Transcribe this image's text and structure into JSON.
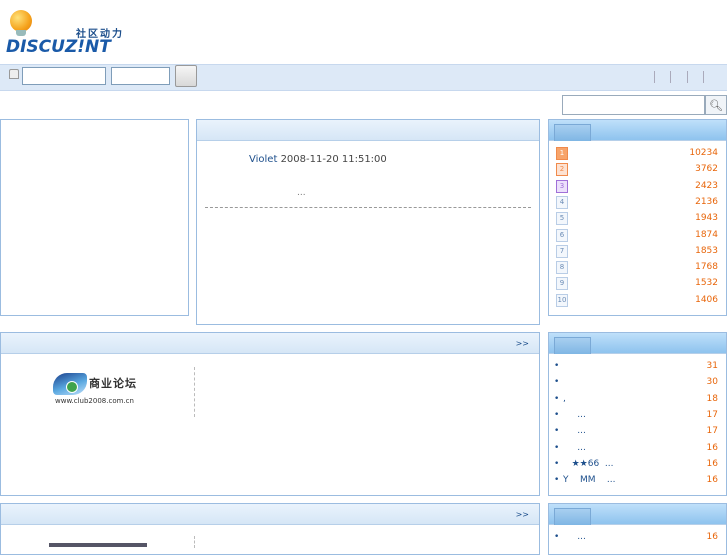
{
  "logo": {
    "cn": "社区动力",
    "en": "DISCUZ!NT"
  },
  "post": {
    "author": "Violet",
    "datetime": "2008-11-20 11:51:00",
    "excerpt": "..."
  },
  "more_label": ">>",
  "ad_logo": {
    "cn": "商业论坛",
    "url": "www.club2008.com.cn"
  },
  "ranking": [
    {
      "n": "1",
      "v": "10234",
      "c": "#f08a4b",
      "bg": "#f7a46a"
    },
    {
      "n": "2",
      "v": "3762",
      "c": "#f08a4b",
      "bg": "#fde2d2"
    },
    {
      "n": "3",
      "v": "2423",
      "c": "#a070d8",
      "bg": "#ece0fb"
    },
    {
      "n": "4",
      "v": "2136"
    },
    {
      "n": "5",
      "v": "1943"
    },
    {
      "n": "6",
      "v": "1874"
    },
    {
      "n": "7",
      "v": "1853"
    },
    {
      "n": "8",
      "v": "1768"
    },
    {
      "n": "9",
      "v": "1532"
    },
    {
      "n": "10",
      "v": "1406"
    }
  ],
  "hot_threads": [
    {
      "t": "",
      "v": "31"
    },
    {
      "t": "",
      "v": "30"
    },
    {
      "t": ",",
      "v": "18"
    },
    {
      "t": "     ...",
      "v": "17"
    },
    {
      "t": "     ...",
      "v": "17"
    },
    {
      "t": "     ...",
      "v": "16"
    },
    {
      "t": "   ★★66  ...",
      "v": "16"
    },
    {
      "t": "Y    MM    ...",
      "v": "16"
    }
  ],
  "hot_threads2": [
    {
      "t": "     ...",
      "v": "16"
    }
  ]
}
